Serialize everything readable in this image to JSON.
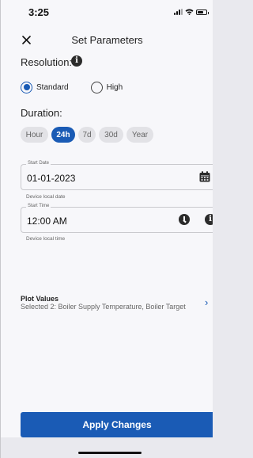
{
  "status_bar": {
    "time": "3:25"
  },
  "header": {
    "title": "Set Parameters",
    "close_icon": "close-icon"
  },
  "resolution": {
    "label": "Resolution:",
    "options": [
      {
        "label": "Standard",
        "selected": true
      },
      {
        "label": "High",
        "selected": false
      }
    ]
  },
  "duration": {
    "label": "Duration:",
    "options": [
      "Hour",
      "24h",
      "7d",
      "30d",
      "Year"
    ],
    "selected": "24h"
  },
  "start_date": {
    "legend": "Start Date",
    "value": "01-01-2023",
    "helper": "Device local date",
    "icon": "calendar-icon"
  },
  "start_time": {
    "legend": "Start Time",
    "value": "12:00 AM",
    "helper": "Device local time",
    "icon": "clock-icon"
  },
  "plot_values": {
    "title": "Plot Values",
    "subtitle": "Selected 2: Boiler Supply Temperature, Boiler Target"
  },
  "apply_button": {
    "label": "Apply Changes"
  },
  "colors": {
    "accent": "#1a5bb5",
    "chip_bg": "#e2e2e6",
    "background": "#f7f7fa"
  }
}
